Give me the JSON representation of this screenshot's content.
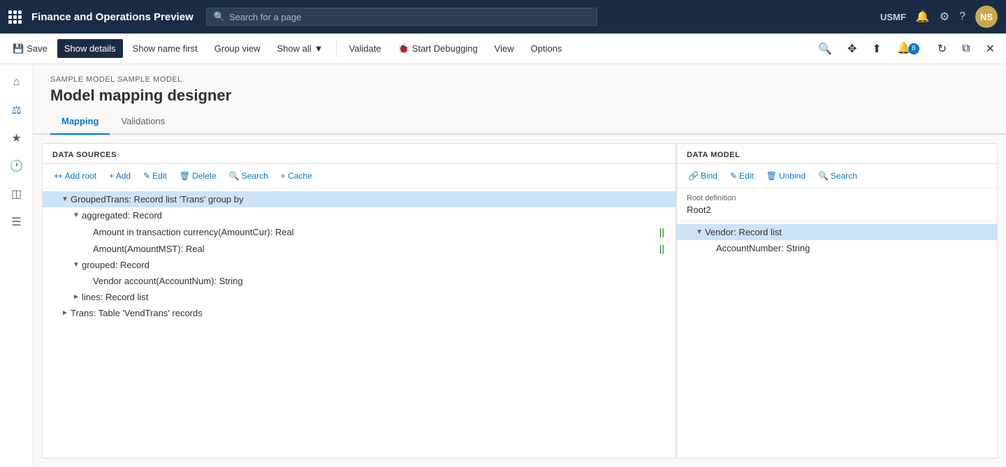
{
  "app": {
    "title": "Finance and Operations Preview",
    "search_placeholder": "Search for a page",
    "user": "USMF",
    "avatar": "NS"
  },
  "commandbar": {
    "save_label": "Save",
    "show_details_label": "Show details",
    "show_name_first_label": "Show name first",
    "group_view_label": "Group view",
    "show_all_label": "Show all",
    "validate_label": "Validate",
    "start_debugging_label": "Start Debugging",
    "view_label": "View",
    "options_label": "Options",
    "notification_badge": "8"
  },
  "page": {
    "breadcrumb": "SAMPLE MODEL SAMPLE MODEL",
    "title": "Model mapping designer"
  },
  "tabs": [
    {
      "id": "mapping",
      "label": "Mapping",
      "active": true
    },
    {
      "id": "validations",
      "label": "Validations",
      "active": false
    }
  ],
  "datasources": {
    "header": "DATA SOURCES",
    "toolbar": {
      "add_root": "+ Add root",
      "add": "+ Add",
      "edit": "Edit",
      "delete": "Delete",
      "search": "Search",
      "cache": "+ Cache"
    },
    "tree": [
      {
        "id": "grouped-trans",
        "indent": 1,
        "expanded": true,
        "selected": true,
        "label": "GroupedTrans: Record list 'Trans' group by",
        "has_children": true
      },
      {
        "id": "aggregated",
        "indent": 2,
        "expanded": true,
        "selected": false,
        "label": "aggregated: Record",
        "has_children": true
      },
      {
        "id": "amount-cur",
        "indent": 3,
        "expanded": false,
        "selected": false,
        "label": "Amount in transaction currency(AmountCur): Real",
        "has_children": false,
        "has_bind": true
      },
      {
        "id": "amount-mst",
        "indent": 3,
        "expanded": false,
        "selected": false,
        "label": "Amount(AmountMST): Real",
        "has_children": false,
        "has_bind": true
      },
      {
        "id": "grouped",
        "indent": 2,
        "expanded": true,
        "selected": false,
        "label": "grouped: Record",
        "has_children": true
      },
      {
        "id": "vendor-account",
        "indent": 3,
        "expanded": false,
        "selected": false,
        "label": "Vendor account(AccountNum): String",
        "has_children": false
      },
      {
        "id": "lines",
        "indent": 2,
        "expanded": false,
        "selected": false,
        "label": "lines: Record list",
        "has_children": true,
        "collapsed": true
      },
      {
        "id": "trans",
        "indent": 1,
        "expanded": false,
        "selected": false,
        "label": "Trans: Table 'VendTrans' records",
        "has_children": true,
        "collapsed": true
      }
    ]
  },
  "datamodel": {
    "header": "DATA MODEL",
    "toolbar": {
      "bind": "Bind",
      "edit": "Edit",
      "unbind": "Unbind",
      "search": "Search"
    },
    "root_def_label": "Root definition",
    "root_def_value": "Root2",
    "tree": [
      {
        "id": "vendor",
        "indent": 1,
        "expanded": true,
        "selected": true,
        "label": "Vendor: Record list",
        "has_children": true
      },
      {
        "id": "account-number",
        "indent": 2,
        "expanded": false,
        "selected": false,
        "label": "AccountNumber: String",
        "has_children": false
      }
    ]
  }
}
